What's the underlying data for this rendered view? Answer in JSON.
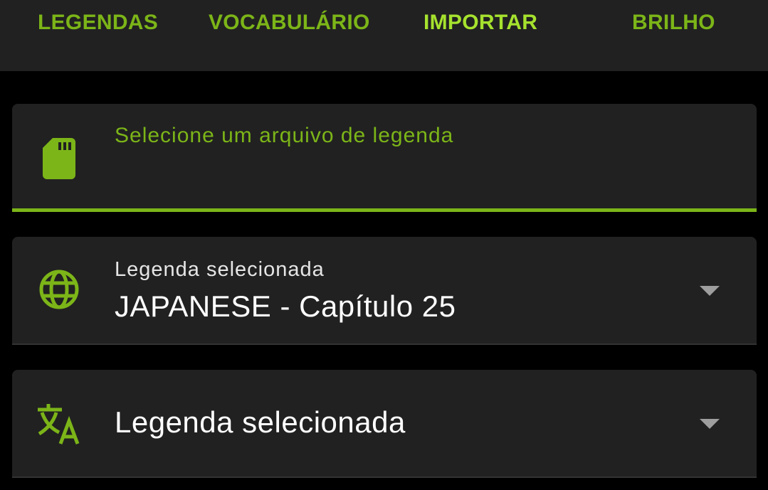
{
  "tabs": [
    {
      "label": "LEGENDAS"
    },
    {
      "label": "VOCABULÁRIO"
    },
    {
      "label": "IMPORTAR",
      "active": true
    },
    {
      "label": "BRILHO"
    }
  ],
  "file_picker": {
    "placeholder": "Selecione um arquivo de legenda",
    "icon": "sd-card-icon"
  },
  "subtitle_select": {
    "label": "Legenda selecionada",
    "value": "JAPANESE - Capítulo 25",
    "icon": "globe-icon"
  },
  "translation_select": {
    "value": "Legenda selecionada",
    "icon": "translate-icon"
  },
  "colors": {
    "accent": "#7cb518",
    "active_tab": "#a6e22e",
    "surface": "#212121",
    "background": "#000000"
  }
}
